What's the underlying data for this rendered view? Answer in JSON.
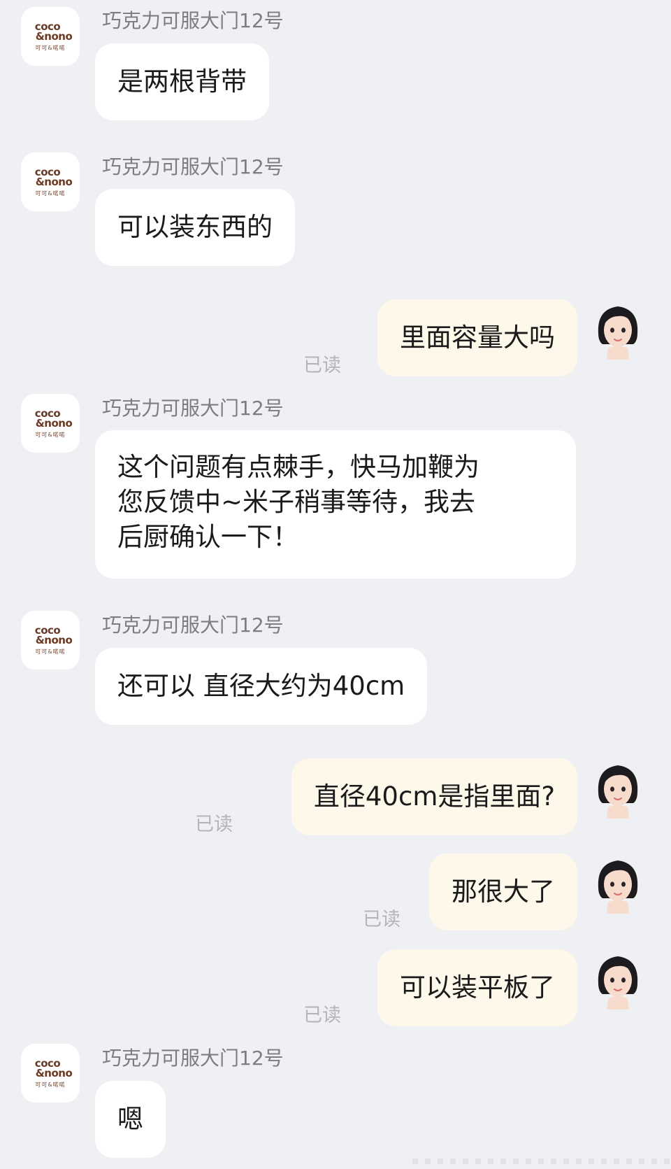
{
  "shop": {
    "name": "巧克力可服大门12号",
    "logo_line1": "coco",
    "logo_line2": "&nono",
    "logo_sub": "可可&喏喏"
  },
  "read_label": "已读",
  "colors": {
    "background": "#eef0f3",
    "incoming_bubble": "#ffffff",
    "outgoing_bubble": "#fdf8ea",
    "sender_name": "#7d7d80",
    "read_receipt": "#b5b5b8",
    "logo_brown": "#6b3a25"
  },
  "messages": [
    {
      "from": "shop",
      "text": "是两根背带"
    },
    {
      "from": "shop",
      "text": "可以装东西的"
    },
    {
      "from": "me",
      "text": "里面容量大吗",
      "status": "已读"
    },
    {
      "from": "shop",
      "lines": [
        "这个问题有点棘手，快马加鞭为",
        "您反馈中~米子稍事等待，我去",
        "后厨确认一下！"
      ]
    },
    {
      "from": "shop",
      "text": "还可以 直径大约为40cm"
    },
    {
      "from": "me",
      "text": "直径40cm是指里面?",
      "status": "已读"
    },
    {
      "from": "me",
      "text": "那很大了",
      "status": "已读"
    },
    {
      "from": "me",
      "text": "可以装平板了",
      "status": "已读"
    },
    {
      "from": "shop",
      "text": "嗯"
    }
  ]
}
